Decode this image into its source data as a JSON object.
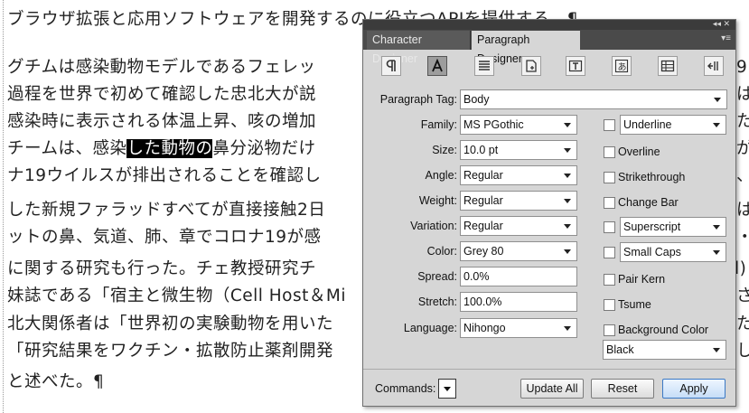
{
  "document": {
    "lines": [
      {
        "text": "ブラウザ拡張と応用ソフトウェアを開発するのに役立つAPIを提供する。¶"
      },
      {
        "text": "グチムは感染動物モデルであるフェレッ"
      },
      {
        "text": "過程を世界で初めて確認した忠北大が説"
      },
      {
        "text": "感染時に表示される体温上昇、咳の増加"
      },
      {
        "before": "チームは、感染",
        "selected": "した動物の",
        "after": "鼻分泌物だけ"
      },
      {
        "text": "ナ19ウイルスが排出されることを確認し"
      },
      {
        "text": "した新規ファラッドすべてが直接接触2日"
      },
      {
        "text": "ットの鼻、気道、肺、章でコロナ19が感"
      },
      {
        "text": "に関する研究も行った。チェ教授研究チ"
      },
      {
        "text": "妹誌である「宿主と微生物（Cell Host＆Mi"
      },
      {
        "text": "北大関係者は「世界初の実験動物を用いた"
      },
      {
        "text": "「研究結果をワクチン・拡散防止薬剤開発"
      },
      {
        "text": "と述べた。¶"
      }
    ],
    "right_edge": [
      "9",
      "は",
      "た",
      "が",
      "",
      "、",
      "は",
      "・",
      "l)",
      "さ",
      "た",
      "し"
    ]
  },
  "panel": {
    "title_controls": "◂◂  ✕",
    "tabs": [
      {
        "label": "Character Designer",
        "active": false
      },
      {
        "label": "Paragraph Designer",
        "active": true
      }
    ],
    "tab_menu_icon": "▾≡",
    "toolbar_icons": [
      "paragraph-mark-icon",
      "character-a-icon",
      "lines-icon",
      "page-corner-icon",
      "text-frame-icon",
      "asian-text-icon",
      "table-icon",
      "direction-icon"
    ],
    "paragraph_tag_label": "Paragraph Tag:",
    "paragraph_tag_value": "Body",
    "fields": [
      {
        "label": "Family:",
        "value": "MS PGothic",
        "dropdown": true
      },
      {
        "label": "Size:",
        "value": "10.0 pt",
        "dropdown": true
      },
      {
        "label": "Angle:",
        "value": "Regular",
        "dropdown": true
      },
      {
        "label": "Weight:",
        "value": "Regular",
        "dropdown": true
      },
      {
        "label": "Variation:",
        "value": "Regular",
        "dropdown": true
      },
      {
        "label": "Color:",
        "value": "Grey 80",
        "dropdown": true
      },
      {
        "label": "Spread:",
        "value": "0.0%",
        "dropdown": false
      },
      {
        "label": "Stretch:",
        "value": "100.0%",
        "dropdown": false
      },
      {
        "label": "Language:",
        "value": "Nihongo",
        "dropdown": true
      }
    ],
    "options": [
      {
        "label": "Underline",
        "dropdown": true
      },
      {
        "label": "Overline",
        "dropdown": false
      },
      {
        "label": "Strikethrough",
        "dropdown": false
      },
      {
        "label": "Change Bar",
        "dropdown": false
      },
      {
        "label": "Superscript",
        "dropdown": true
      },
      {
        "label": "Small Caps",
        "dropdown": true
      },
      {
        "label": "Pair Kern",
        "dropdown": false
      },
      {
        "label": "Tsume",
        "dropdown": false
      },
      {
        "label": "Background Color",
        "dropdown": false
      }
    ],
    "background_color_value": "Black",
    "commands_label": "Commands:",
    "buttons": {
      "update_all": "Update All",
      "reset": "Reset",
      "apply": "Apply"
    }
  }
}
